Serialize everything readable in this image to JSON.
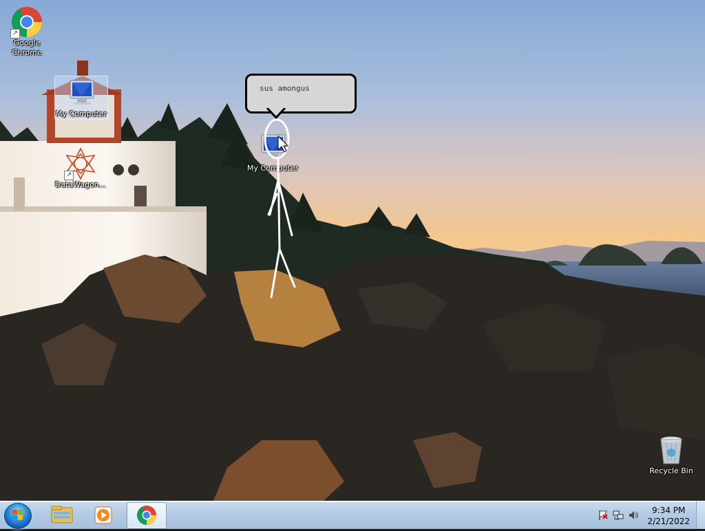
{
  "desktop": {
    "icons": [
      {
        "label": "Google Chrome",
        "icon": "chrome-icon"
      },
      {
        "label": "My Computer",
        "icon": "computer-icon"
      },
      {
        "label": "DataWagon...",
        "icon": "datawagon-icon"
      },
      {
        "label": "My Computer",
        "icon": "computer-icon"
      },
      {
        "label": "Recycle Bin",
        "icon": "recycle-bin-icon"
      }
    ],
    "bubble_text": "sus amongus"
  },
  "taskbar": {
    "items": [
      "start-orb-icon",
      "explorer-icon",
      "media-player-icon",
      "chrome-icon"
    ],
    "tray": {
      "icons": [
        "action-center-flag-icon",
        "network-icon",
        "volume-icon"
      ],
      "time": "9:34 PM",
      "date": "2/21/2022"
    }
  },
  "colors": {
    "taskbar": "#b3cbe4",
    "sky_top": "#8eb0d8",
    "sky_horizon": "#f1c58e"
  }
}
